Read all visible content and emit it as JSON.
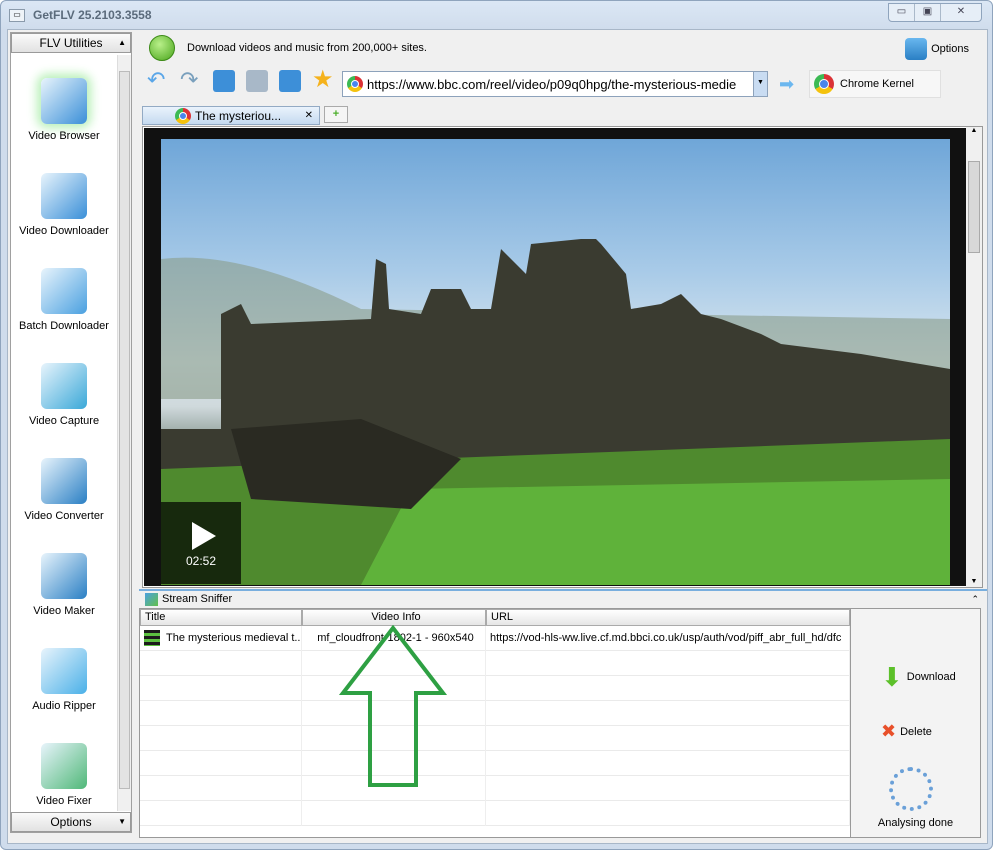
{
  "window": {
    "title": "GetFLV 25.2103.3558",
    "controls": [
      "minimize",
      "maximize",
      "close"
    ]
  },
  "sidebar": {
    "header": "FLV Utilities",
    "footer": "Options",
    "items": [
      {
        "label": "Video Browser",
        "icon": "video-browser-icon",
        "active": true,
        "color": "#3a8fd8"
      },
      {
        "label": "Video Downloader",
        "icon": "video-downloader-icon",
        "color": "#3a8fd8"
      },
      {
        "label": "Batch Downloader",
        "icon": "batch-downloader-icon",
        "color": "#4aa0e0"
      },
      {
        "label": "Video Capture",
        "icon": "video-capture-icon",
        "color": "#3aa8d8"
      },
      {
        "label": "Video Converter",
        "icon": "video-converter-icon",
        "color": "#2a7fc4"
      },
      {
        "label": "Video Maker",
        "icon": "video-maker-icon",
        "color": "#2a7fc4"
      },
      {
        "label": "Audio Ripper",
        "icon": "audio-ripper-icon",
        "color": "#4ab0e8"
      },
      {
        "label": "Video Fixer",
        "icon": "video-fixer-icon",
        "color": "#50b878"
      }
    ]
  },
  "banner": {
    "text": "Download videos and music from 200,000+ sites.",
    "options_label": "Options"
  },
  "toolbar": {
    "buttons": [
      "back",
      "forward",
      "refresh",
      "stop",
      "home",
      "favorites"
    ],
    "url": "https://www.bbc.com/reel/video/p09q0hpg/the-mysterious-medie",
    "kernel": "Chrome Kernel"
  },
  "tabs": [
    {
      "label": "The mysteriou..."
    }
  ],
  "video": {
    "duration": "02:52"
  },
  "sniffer": {
    "title": "Stream Sniffer",
    "columns": [
      "Title",
      "Video Info",
      "URL"
    ],
    "rows": [
      {
        "title": "The mysterious medieval t...",
        "info": "mf_cloudfront-1802-1 - 960x540",
        "url": "https://vod-hls-ww.live.cf.md.bbci.co.uk/usp/auth/vod/piff_abr_full_hd/dfc"
      }
    ],
    "download_label": "Download",
    "delete_label": "Delete",
    "status": "Analysing done"
  },
  "colors": {
    "accent": "#78aede",
    "arrow": "#2ea043"
  }
}
